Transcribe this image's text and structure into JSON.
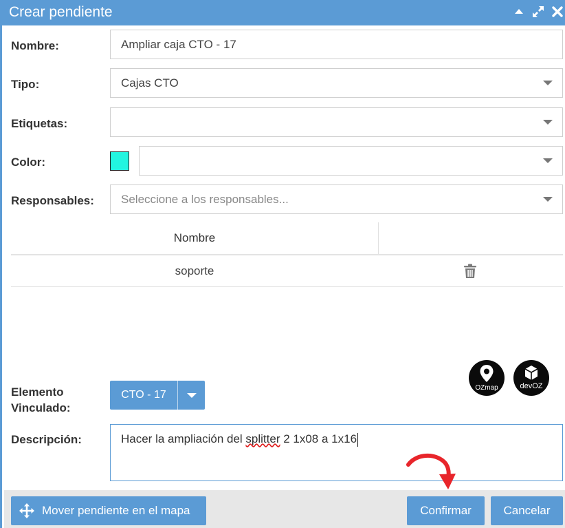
{
  "window": {
    "title": "Crear pendiente",
    "icons": [
      "collapse-icon",
      "expand-icon",
      "close-icon"
    ]
  },
  "form": {
    "nombre": {
      "label": "Nombre:",
      "value": "Ampliar caja CTO - 17"
    },
    "tipo": {
      "label": "Tipo:",
      "value": "Cajas CTO"
    },
    "etiquetas": {
      "label": "Etiquetas:",
      "value": ""
    },
    "color": {
      "label": "Color:",
      "swatch": "#22f5e0",
      "value": ""
    },
    "responsables": {
      "label": "Responsables:",
      "placeholder": "Seleccione a los responsables..."
    },
    "table": {
      "headers": [
        "Nombre",
        ""
      ],
      "rows": [
        {
          "nombre": "soporte"
        }
      ]
    },
    "elemento": {
      "label_line1": "Elemento",
      "label_line2": "Vinculado:",
      "value": "CTO - 17"
    },
    "descripcion": {
      "label": "Descripción:",
      "text_before": "Hacer la ampliación del ",
      "misspelled": "splitter",
      "text_after": " 2 1x08 a 1x16"
    }
  },
  "logos": {
    "ozmap_text": "OZmap",
    "devoz_text": "devOZ"
  },
  "footer": {
    "move_label": "Mover pendiente en el mapa",
    "confirm_label": "Confirmar",
    "cancel_label": "Cancelar"
  },
  "colors": {
    "accent": "#5b9bd5",
    "annotation_arrow": "#e8252b"
  }
}
